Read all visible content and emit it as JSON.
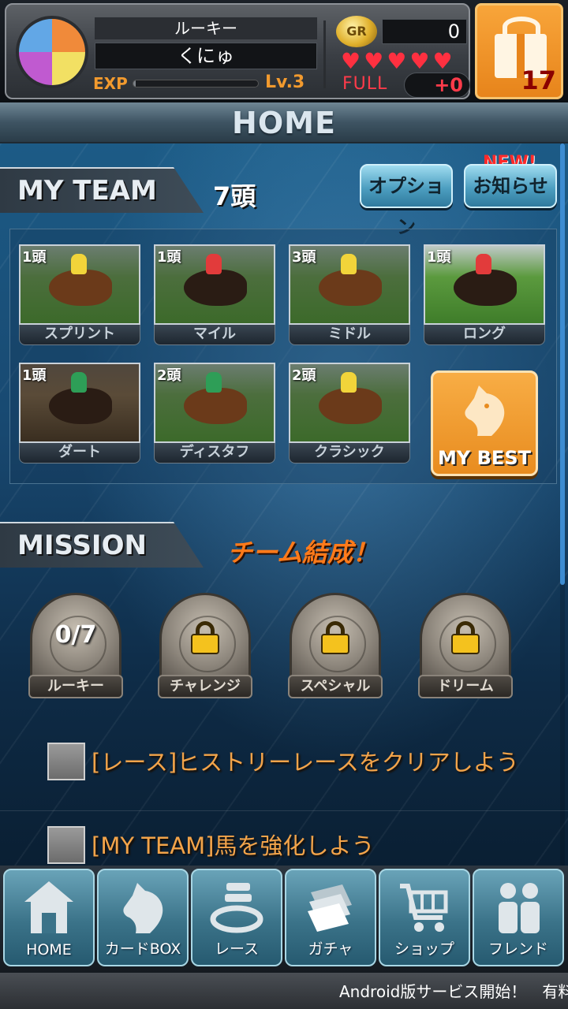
{
  "status": {
    "rank_label": "ルーキー",
    "player_name": "くにゅ",
    "exp_label": "EXP",
    "exp_progress": 0.02,
    "level": "Lv.3",
    "coin_badge": "GR",
    "coins": "0",
    "hearts_count": 5,
    "stamina_label": "FULL",
    "stamina_bonus": "+0",
    "gift_count": "17"
  },
  "page_title": "HOME",
  "my_team": {
    "header": "MY TEAM",
    "count": "7頭",
    "option_button": "オプション",
    "news_button": "お知らせ",
    "new_badge": "NEW!",
    "categories": [
      {
        "count": "1頭",
        "label": "スプリント"
      },
      {
        "count": "1頭",
        "label": "マイル"
      },
      {
        "count": "3頭",
        "label": "ミドル"
      },
      {
        "count": "1頭",
        "label": "ロング"
      },
      {
        "count": "1頭",
        "label": "ダート"
      },
      {
        "count": "2頭",
        "label": "ディスタフ"
      },
      {
        "count": "2頭",
        "label": "クラシック"
      }
    ],
    "my_best_button": "MY BEST"
  },
  "mission": {
    "header": "MISSION",
    "subtitle": "チーム結成！",
    "medals": [
      {
        "label": "ルーキー",
        "progress": "0/7",
        "locked": false
      },
      {
        "label": "チャレンジ",
        "locked": true
      },
      {
        "label": "スペシャル",
        "locked": true
      },
      {
        "label": "ドリーム",
        "locked": true
      }
    ],
    "tasks": [
      "[レース]ヒストリーレースをクリアしよう",
      "[MY TEAM]馬を強化しよう"
    ]
  },
  "nav": [
    {
      "label": "HOME",
      "icon": "home-icon"
    },
    {
      "label": "カードBOX",
      "icon": "horse-head-icon"
    },
    {
      "label": "レース",
      "icon": "race-gate-icon"
    },
    {
      "label": "ガチャ",
      "icon": "card-stack-icon"
    },
    {
      "label": "ショップ",
      "icon": "cart-icon"
    },
    {
      "label": "フレンド",
      "icon": "friends-icon"
    }
  ],
  "ticker": "Android版サービス開始！　有料"
}
